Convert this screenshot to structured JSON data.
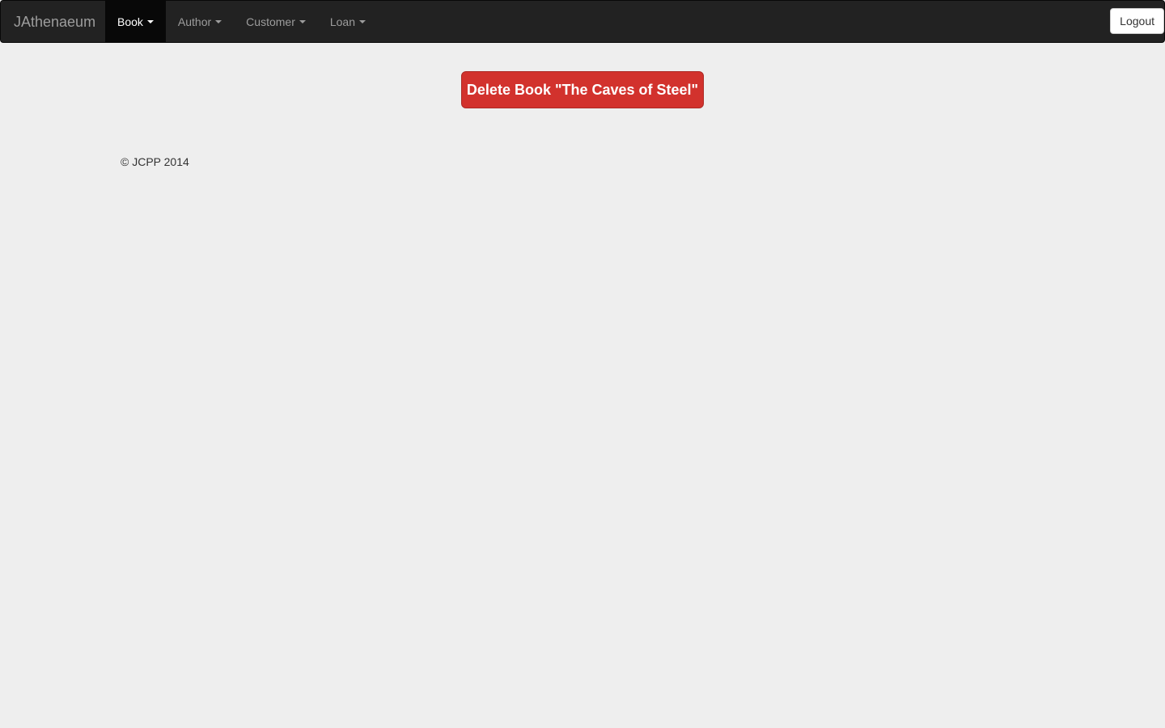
{
  "navbar": {
    "brand": "JAthenaeum",
    "items": [
      {
        "label": "Book",
        "active": true
      },
      {
        "label": "Author",
        "active": false
      },
      {
        "label": "Customer",
        "active": false
      },
      {
        "label": "Loan",
        "active": false
      }
    ],
    "logout_label": "Logout"
  },
  "main": {
    "delete_button_label": "Delete Book \"The Caves of Steel\""
  },
  "footer": {
    "copyright": "© JCPP 2014"
  },
  "colors": {
    "navbar_bg": "#222222",
    "active_tab_bg": "#080808",
    "danger": "#d2322d",
    "page_bg": "#eeeeee"
  }
}
